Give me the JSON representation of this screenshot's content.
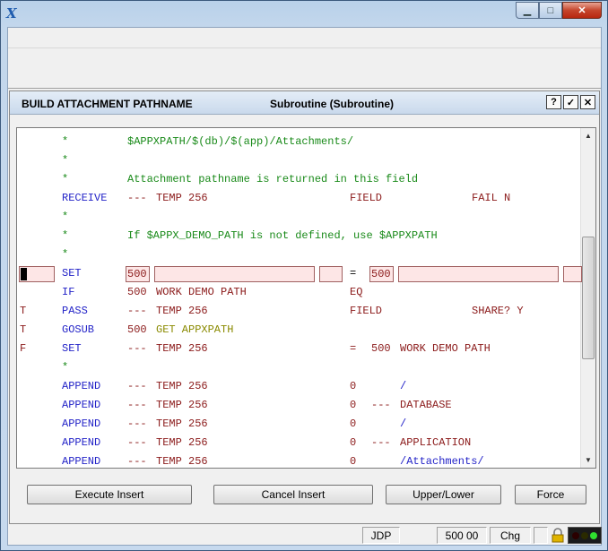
{
  "window": {
    "minimize_glyph": "▁",
    "maximize_glyph": "□",
    "close_glyph": "✕"
  },
  "dialog": {
    "name": "BUILD ATTACHMENT PATHNAME",
    "subtitle": "Subroutine  (Subroutine)",
    "help_label": "?",
    "ok_label": "✓",
    "close_label": "✕"
  },
  "code_lines": [
    {
      "mark": "",
      "cmd": "*",
      "cmd_color": "green",
      "text": "$APPXPATH/$(db)/$(app)/Attachments/",
      "text_color": "green"
    },
    {
      "mark": "",
      "cmd": "*",
      "cmd_color": "green",
      "text": "",
      "text_color": "green"
    },
    {
      "mark": "",
      "cmd": "*",
      "cmd_color": "green",
      "text": "Attachment pathname is returned in this field",
      "text_color": "green"
    },
    {
      "mark": "",
      "cmd": "RECEIVE",
      "cmd_color": "blue",
      "a": "---",
      "b": "TEMP 256",
      "op": "FIELD",
      "c": "",
      "d": "",
      "e": "FAIL N"
    },
    {
      "mark": "",
      "cmd": "*",
      "cmd_color": "green",
      "text": "",
      "text_color": "green"
    },
    {
      "mark": "",
      "cmd": "*",
      "cmd_color": "green",
      "text": "If $APPX_DEMO_PATH is not defined, use $APPXPATH",
      "text_color": "green"
    },
    {
      "mark": "",
      "cmd": "*",
      "cmd_color": "green",
      "text": "",
      "text_color": "green"
    },
    {
      "mark": "",
      "cmd": "SET",
      "cmd_color": "blue",
      "edit": true,
      "a": "500",
      "op": "=",
      "c": "500"
    },
    {
      "mark": "",
      "cmd": "IF",
      "cmd_color": "blue",
      "a": "500",
      "b": "WORK DEMO PATH",
      "op": "EQ",
      "c": "",
      "d": "",
      "e": ""
    },
    {
      "mark": "T",
      "cmd": "PASS",
      "cmd_color": "blue",
      "a": "---",
      "b": "TEMP 256",
      "op": "FIELD",
      "c": "",
      "d": "",
      "e": "SHARE? Y"
    },
    {
      "mark": "T",
      "cmd": "GOSUB",
      "cmd_color": "blue",
      "a": "500",
      "b": "GET APPXPATH",
      "op": "",
      "c": "",
      "d": "",
      "e": "",
      "b_color": "olive"
    },
    {
      "mark": "F",
      "cmd": "SET",
      "cmd_color": "blue",
      "a": "---",
      "b": "TEMP 256",
      "op": "=",
      "c": "500",
      "d": "WORK DEMO PATH",
      "e": ""
    },
    {
      "mark": "",
      "cmd": "*",
      "cmd_color": "green",
      "text": "",
      "text_color": "green"
    },
    {
      "mark": "",
      "cmd": "APPEND",
      "cmd_color": "blue",
      "a": "---",
      "b": "TEMP 256",
      "op": "0",
      "c": "",
      "d": "/",
      "e": "",
      "d_color": "blue"
    },
    {
      "mark": "",
      "cmd": "APPEND",
      "cmd_color": "blue",
      "a": "---",
      "b": "TEMP 256",
      "op": "0",
      "c": "---",
      "d": "DATABASE",
      "e": ""
    },
    {
      "mark": "",
      "cmd": "APPEND",
      "cmd_color": "blue",
      "a": "---",
      "b": "TEMP 256",
      "op": "0",
      "c": "",
      "d": "/",
      "e": "",
      "d_color": "blue"
    },
    {
      "mark": "",
      "cmd": "APPEND",
      "cmd_color": "blue",
      "a": "---",
      "b": "TEMP 256",
      "op": "0",
      "c": "---",
      "d": "APPLICATION",
      "e": ""
    },
    {
      "mark": "",
      "cmd": "APPEND",
      "cmd_color": "blue",
      "a": "---",
      "b": "TEMP 256",
      "op": "0",
      "c": "",
      "d": "/Attachments/",
      "e": "",
      "d_color": "blue"
    }
  ],
  "buttons": {
    "execute_insert": "Execute Insert",
    "cancel_insert": "Cancel Insert",
    "upper_lower": "Upper/Lower",
    "force": "Force"
  },
  "status": {
    "user": "JDP",
    "value": "500 00",
    "mode": "Chg"
  },
  "colors": {
    "green": "#198a19",
    "blue": "#2424c8",
    "red": "#8b1a1a",
    "olive": "#8a8a00"
  }
}
